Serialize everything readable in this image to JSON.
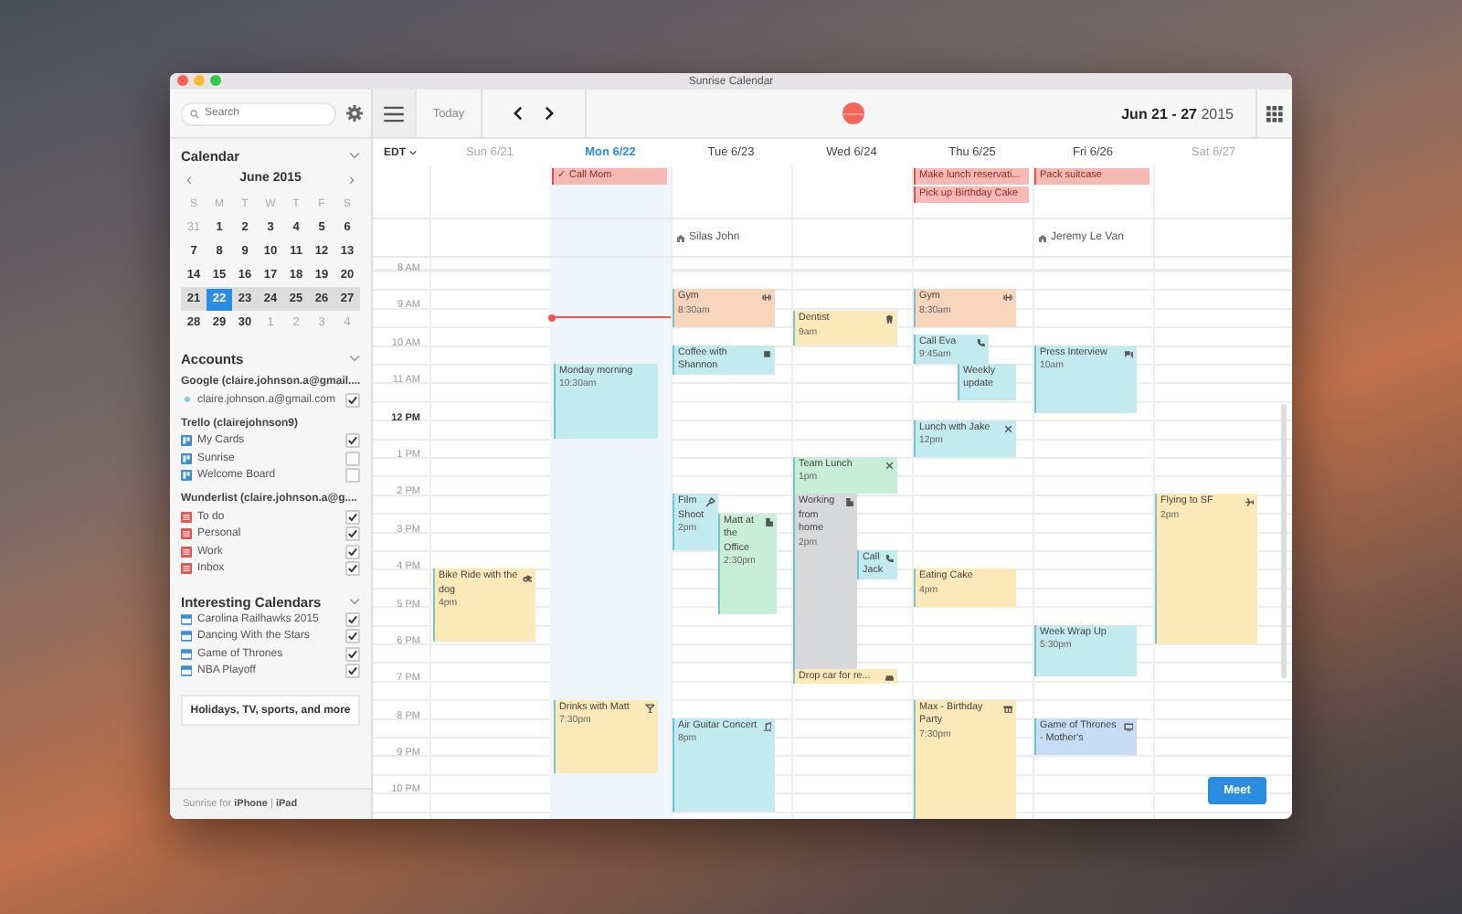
{
  "window": {
    "title": "Sunrise Calendar"
  },
  "sidebar": {
    "search": {
      "placeholder": "Search"
    },
    "calendar": {
      "title": "Calendar",
      "month": "June 2015",
      "prev": "‹",
      "next": "›",
      "weekdays": [
        "S",
        "M",
        "T",
        "W",
        "T",
        "F",
        "S"
      ],
      "weeks": [
        {
          "days": [
            {
              "day": "31",
              "muted": true,
              "selected": false
            },
            {
              "day": "1",
              "muted": false,
              "selected": false
            },
            {
              "day": "2",
              "muted": false,
              "selected": false
            },
            {
              "day": "3",
              "muted": false,
              "selected": false
            },
            {
              "day": "4",
              "muted": false,
              "selected": false
            },
            {
              "day": "5",
              "muted": false,
              "selected": false
            },
            {
              "day": "6",
              "muted": false,
              "selected": false
            }
          ]
        },
        {
          "days": [
            {
              "day": "7",
              "muted": false,
              "selected": false
            },
            {
              "day": "8",
              "muted": false,
              "selected": false
            },
            {
              "day": "9",
              "muted": false,
              "selected": false
            },
            {
              "day": "10",
              "muted": false,
              "selected": false
            },
            {
              "day": "11",
              "muted": false,
              "selected": false
            },
            {
              "day": "12",
              "muted": false,
              "selected": false
            },
            {
              "day": "13",
              "muted": false,
              "selected": false
            }
          ]
        },
        {
          "days": [
            {
              "day": "14",
              "muted": false,
              "selected": false
            },
            {
              "day": "15",
              "muted": false,
              "selected": false
            },
            {
              "day": "16",
              "muted": false,
              "selected": false
            },
            {
              "day": "17",
              "muted": false,
              "selected": false
            },
            {
              "day": "18",
              "muted": false,
              "selected": false
            },
            {
              "day": "19",
              "muted": false,
              "selected": false
            },
            {
              "day": "20",
              "muted": false,
              "selected": false
            }
          ]
        },
        {
          "days": [
            {
              "day": "21",
              "muted": false,
              "selected": false
            },
            {
              "day": "22",
              "muted": false,
              "selected": true
            },
            {
              "day": "23",
              "muted": false,
              "selected": false
            },
            {
              "day": "24",
              "muted": false,
              "selected": false
            },
            {
              "day": "25",
              "muted": false,
              "selected": false
            },
            {
              "day": "26",
              "muted": false,
              "selected": false
            },
            {
              "day": "27",
              "muted": false,
              "selected": false
            }
          ]
        },
        {
          "days": [
            {
              "day": "28",
              "muted": false,
              "selected": false
            },
            {
              "day": "29",
              "muted": false,
              "selected": false
            },
            {
              "day": "30",
              "muted": false,
              "selected": false
            },
            {
              "day": "1",
              "muted": true,
              "selected": false
            },
            {
              "day": "2",
              "muted": true,
              "selected": false
            },
            {
              "day": "3",
              "muted": true,
              "selected": false
            },
            {
              "day": "4",
              "muted": true,
              "selected": false
            }
          ]
        }
      ]
    },
    "sections": [
      {
        "title": "Accounts",
        "groups": [
          {
            "name": "Google (claire.johnson.a@gmail....",
            "items": [
              {
                "label": "claire.johnson.a@gmail.com",
                "kind": "dot",
                "color": "#7fd3d8",
                "checked": true
              }
            ]
          },
          {
            "name": "Trello (clairejohnson9)",
            "items": [
              {
                "label": "My Cards",
                "kind": "board",
                "color": "#3a8fd6",
                "checked": true
              },
              {
                "label": "Sunrise",
                "kind": "board",
                "color": "#3a8fd6",
                "checked": false
              },
              {
                "label": "Welcome Board",
                "kind": "board",
                "color": "#3a8fd6",
                "checked": false
              }
            ]
          },
          {
            "name": "Wunderlist (claire.johnson.a@g....",
            "items": [
              {
                "label": "To do",
                "kind": "list",
                "color": "#e8574f",
                "checked": true
              },
              {
                "label": "Personal",
                "kind": "list",
                "color": "#e8574f",
                "checked": true
              },
              {
                "label": "Work",
                "kind": "list",
                "color": "#e8574f",
                "checked": true
              },
              {
                "label": "Inbox",
                "kind": "list",
                "color": "#e8574f",
                "checked": true
              }
            ]
          }
        ]
      },
      {
        "title": "Interesting Calendars",
        "groups": [
          {
            "items": [
              {
                "label": "Carolina Railhawks 2015",
                "kind": "calendar",
                "color": "#3a8fd6",
                "checked": true
              },
              {
                "label": "Dancing With the Stars",
                "kind": "calendar",
                "color": "#3a8fd6",
                "checked": true
              },
              {
                "label": "Game of Thrones",
                "kind": "calendar",
                "color": "#3a8fd6",
                "checked": true
              },
              {
                "label": "NBA Playoff",
                "kind": "calendar",
                "color": "#3a8fd6",
                "checked": true
              }
            ]
          }
        ]
      }
    ],
    "more_button": "Holidays, TV, sports, and more",
    "footer": "Sunrise for **iPhone** | **iPad**"
  },
  "toolbar": {
    "today": "Today",
    "range": "**Jun 21 - 27** 2015"
  },
  "timezone": "EDT",
  "days": [
    {
      "label": "Sun 6/21",
      "selected": false,
      "weekend": true,
      "events": [
        {
          "title": "Bike Ride with the dog",
          "time": "4pm",
          "color": "#fbe9b9"
        }
      ]
    },
    {
      "label": "Mon 6/22",
      "selected": true,
      "weekend": false,
      "all_day": [
        {
          "title": "✓ Call Mom"
        }
      ],
      "events": [
        {
          "title": "Monday morning",
          "time": "10:30am",
          "color": "#c3eaee"
        },
        {
          "title": "Drinks with Matt",
          "time": "7:30pm",
          "color": "#fbe9b9"
        }
      ]
    },
    {
      "label": "Tue 6/23",
      "selected": false,
      "weekend": false,
      "contacts": [
        "Silas John"
      ],
      "events": [
        {
          "title": "Gym",
          "time": "8:30am",
          "color": "#f7d6bd"
        },
        {
          "title": "Coffee with Shannon",
          "color": "#c3eaee"
        },
        {
          "title": "Film Shoot",
          "time": "2pm",
          "color": "#c3eaee"
        },
        {
          "title": "Matt at the Office",
          "time": "2:30pm",
          "color": "#c9eed8"
        },
        {
          "title": "Air Guitar Concert",
          "time": "8pm",
          "color": "#c3eaee"
        }
      ]
    },
    {
      "label": "Wed 6/24",
      "selected": false,
      "weekend": false,
      "events": [
        {
          "title": "Dentist",
          "time": "9am",
          "color": "#fbe9b9"
        },
        {
          "title": "Team Lunch",
          "time": "1pm",
          "color": "#c9eed8"
        },
        {
          "title": "Working from home",
          "time": "2pm",
          "color": "#d6d8da"
        },
        {
          "title": "Call Jack",
          "color": "#c3eaee"
        },
        {
          "title": "Drop car for re...",
          "color": "#fbe9b9"
        }
      ]
    },
    {
      "label": "Thu 6/25",
      "selected": false,
      "weekend": false,
      "all_day": [
        {
          "title": "Make lunch reservati..."
        },
        {
          "title": "Pick up Birthday Cake"
        }
      ],
      "events": [
        {
          "title": "Gym",
          "time": "8:30am",
          "color": "#f7d6bd"
        },
        {
          "title": "Call Eva",
          "time": "9:45am",
          "color": "#c3eaee"
        },
        {
          "title": "Weekly update",
          "color": "#c3eaee"
        },
        {
          "title": "Lunch with Jake",
          "time": "12pm",
          "color": "#c3eaee"
        },
        {
          "title": "Eating Cake",
          "time": "4pm",
          "color": "#fbe9b9"
        },
        {
          "title": "Max - Birthday Party",
          "time": "7:30pm",
          "color": "#fbe9b9"
        }
      ]
    },
    {
      "label": "Fri 6/26",
      "selected": false,
      "weekend": false,
      "all_day": [
        {
          "title": "Pack suitcase"
        }
      ],
      "contacts": [
        "Jeremy Le Van"
      ],
      "events": [
        {
          "title": "Press Interview",
          "time": "10am",
          "color": "#c3eaee"
        },
        {
          "title": "Week Wrap Up",
          "time": "5:30pm",
          "color": "#c3eaee"
        },
        {
          "title": "Game of Thrones - Mother's",
          "color": "#c8dcf6"
        }
      ]
    },
    {
      "label": "Sat 6/27",
      "selected": false,
      "weekend": true,
      "events": [
        {
          "title": "Flying to SF",
          "time": "2pm",
          "color": "#fbe9b9"
        }
      ]
    }
  ],
  "hours": [
    {
      "label": "8 AM",
      "noon": false
    },
    {
      "label": "9 AM",
      "noon": false
    },
    {
      "label": "10 AM",
      "noon": false
    },
    {
      "label": "11 AM",
      "noon": false
    },
    {
      "label": "12 PM",
      "noon": true
    },
    {
      "label": "1 PM",
      "noon": false
    },
    {
      "label": "2 PM",
      "noon": false
    },
    {
      "label": "3 PM",
      "noon": false
    },
    {
      "label": "4 PM",
      "noon": false
    },
    {
      "label": "5 PM",
      "noon": false
    },
    {
      "label": "6 PM",
      "noon": false
    },
    {
      "label": "7 PM",
      "noon": false
    },
    {
      "label": "8 PM",
      "noon": false
    },
    {
      "label": "9 PM",
      "noon": false
    },
    {
      "label": "10 PM",
      "noon": false
    }
  ],
  "meet_button": "Meet"
}
